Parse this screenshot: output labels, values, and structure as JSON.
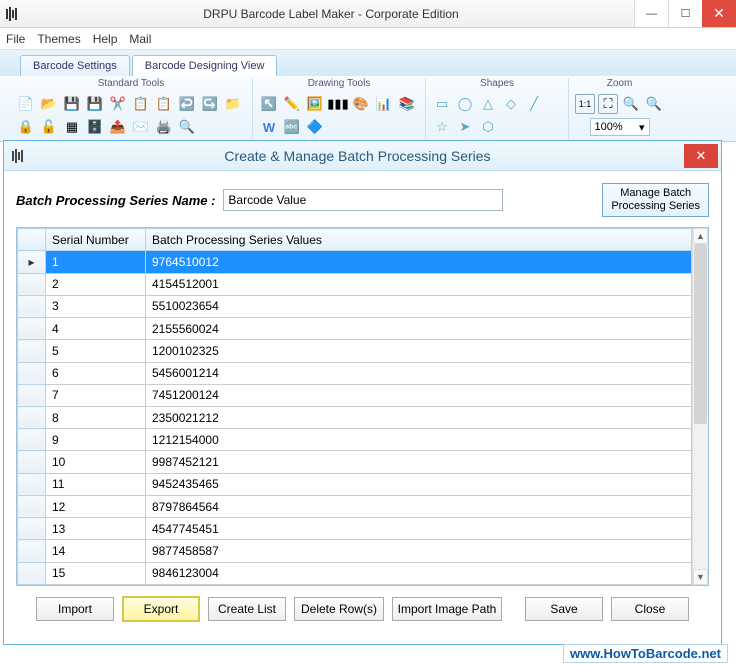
{
  "app": {
    "title": "DRPU Barcode Label Maker - Corporate Edition"
  },
  "menu": {
    "file": "File",
    "themes": "Themes",
    "help": "Help",
    "mail": "Mail"
  },
  "tabs": {
    "settings": "Barcode Settings",
    "designing": "Barcode Designing View"
  },
  "ribbon": {
    "standard": "Standard Tools",
    "drawing": "Drawing Tools",
    "shapes": "Shapes",
    "zoom": "Zoom",
    "zoomvalue": "100%"
  },
  "dialog": {
    "title": "Create & Manage Batch Processing Series",
    "name_label": "Batch Processing Series Name  :",
    "name_value": "Barcode Value",
    "manage_btn_l1": "Manage  Batch",
    "manage_btn_l2": "Processing Series",
    "col_rowhead": "",
    "col_sn": "Serial Number",
    "col_val": "Batch Processing Series Values",
    "rows": [
      {
        "sn": "1",
        "val": "9764510012"
      },
      {
        "sn": "2",
        "val": "4154512001"
      },
      {
        "sn": "3",
        "val": "5510023654"
      },
      {
        "sn": "4",
        "val": "2155560024"
      },
      {
        "sn": "5",
        "val": "1200102325"
      },
      {
        "sn": "6",
        "val": "5456001214"
      },
      {
        "sn": "7",
        "val": "7451200124"
      },
      {
        "sn": "8",
        "val": "2350021212"
      },
      {
        "sn": "9",
        "val": "1212154000"
      },
      {
        "sn": "10",
        "val": "9987452121"
      },
      {
        "sn": "11",
        "val": "9452435465"
      },
      {
        "sn": "12",
        "val": "8797864564"
      },
      {
        "sn": "13",
        "val": "4547745451"
      },
      {
        "sn": "14",
        "val": "9877458587"
      },
      {
        "sn": "15",
        "val": "9846123004"
      }
    ],
    "selected_row": 0,
    "buttons": {
      "import": "Import",
      "export": "Export",
      "create": "Create List",
      "delete": "Delete Row(s)",
      "imgpath": "Import Image Path",
      "save": "Save",
      "close": "Close"
    }
  },
  "watermark": "www.HowToBarcode.net"
}
